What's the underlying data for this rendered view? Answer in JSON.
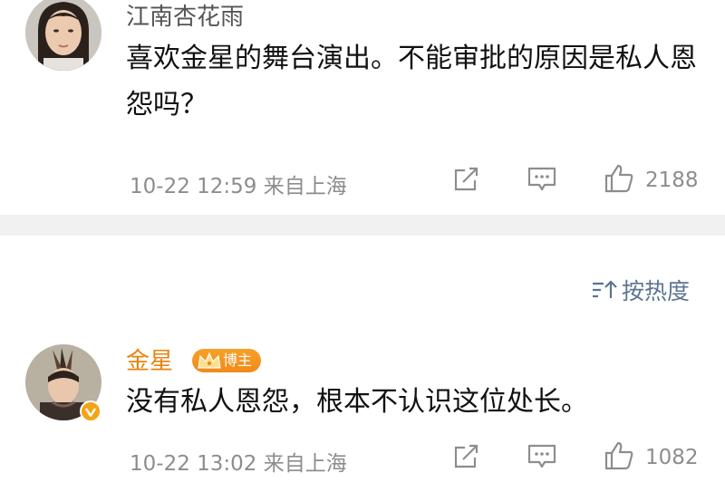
{
  "comments": [
    {
      "author": "江南杏花雨",
      "text": "喜欢金星的舞台演出。不能审批的原因是私人恩怨吗？",
      "time": "10-22 12:59 来自上海",
      "likes": "2188"
    },
    {
      "author": "金星",
      "badge": "博主",
      "text": "没有私人恩怨，根本不认识这位处长。",
      "time": "10-22 13:02 来自上海",
      "likes": "1082"
    }
  ],
  "sort": {
    "label": "按热度"
  },
  "colors": {
    "accent_name": "#e8830e",
    "meta_gray": "#8d8d8d",
    "link_blue": "#5c7593",
    "divider": "#f1f1f1",
    "badge": "#f08a1a"
  },
  "icons": [
    "share-icon",
    "comment-icon",
    "like-icon",
    "sort-icon",
    "crown-icon",
    "verified-icon"
  ]
}
